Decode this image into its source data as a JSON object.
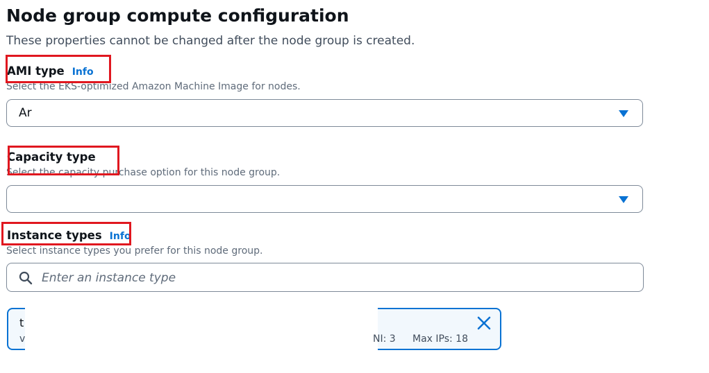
{
  "section": {
    "title": "Node group compute configuration",
    "subtitle": "These properties cannot be changed after the node group is created."
  },
  "ami_type": {
    "label": "AMI type",
    "info": "Info",
    "description": "Select the EKS-optimized Amazon Machine Image for nodes.",
    "value": "Ar"
  },
  "capacity_type": {
    "label": "Capacity type",
    "description": "Select the capacity purchase option for this node group.",
    "value": ""
  },
  "instance_types": {
    "label": "Instance types",
    "info": "Info",
    "description": "Select instance types you prefer for this node group.",
    "placeholder": "Enter an instance type",
    "token": {
      "name_start": "t",
      "detail_start": "v",
      "enis": "NI: 3",
      "max_ips": "Max IPs: 18"
    }
  },
  "colors": {
    "link": "#0972d3",
    "highlight": "#e0171f",
    "border": "#7d8998"
  },
  "icons": {
    "dropdown": "caret-down-icon",
    "search": "search-icon",
    "dismiss": "close-icon"
  }
}
